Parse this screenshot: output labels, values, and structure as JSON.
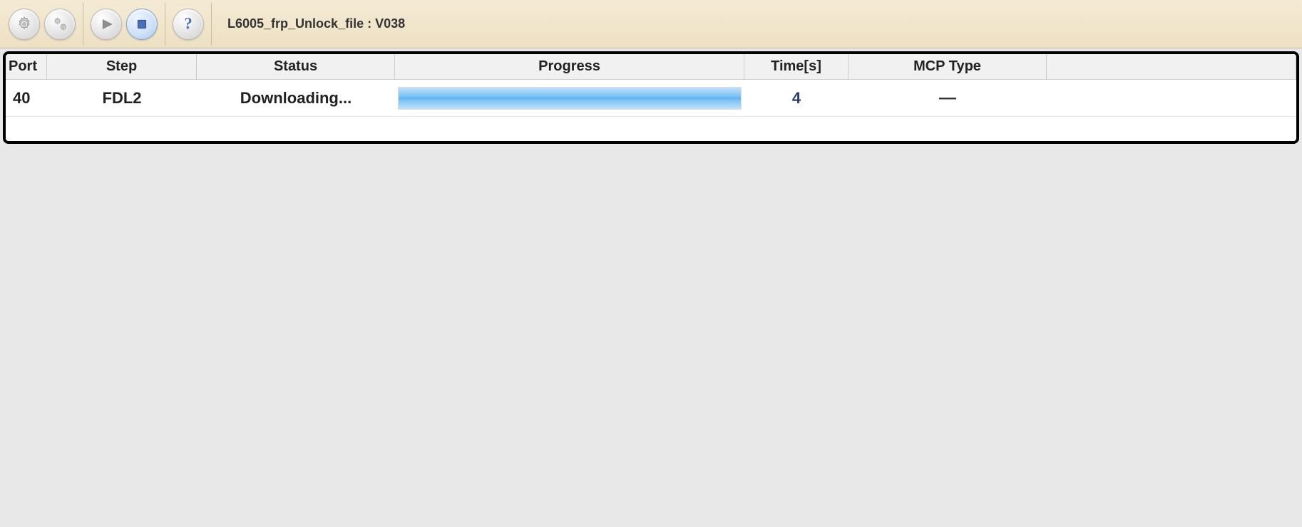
{
  "toolbar": {
    "title": "L6005_frp_Unlock_file : V038",
    "buttons": {
      "settings": "settings-icon",
      "settings_double": "double-gear-icon",
      "start": "play-icon",
      "stop": "stop-icon",
      "help": "help-icon"
    }
  },
  "table": {
    "headers": {
      "port": "Port",
      "step": "Step",
      "status": "Status",
      "progress": "Progress",
      "time": "Time[s]",
      "mcp": "MCP Type"
    },
    "rows": [
      {
        "port": "40",
        "step": "FDL2",
        "status": "Downloading...",
        "progress_percent": 100,
        "time": "4",
        "mcp": "—"
      }
    ]
  }
}
